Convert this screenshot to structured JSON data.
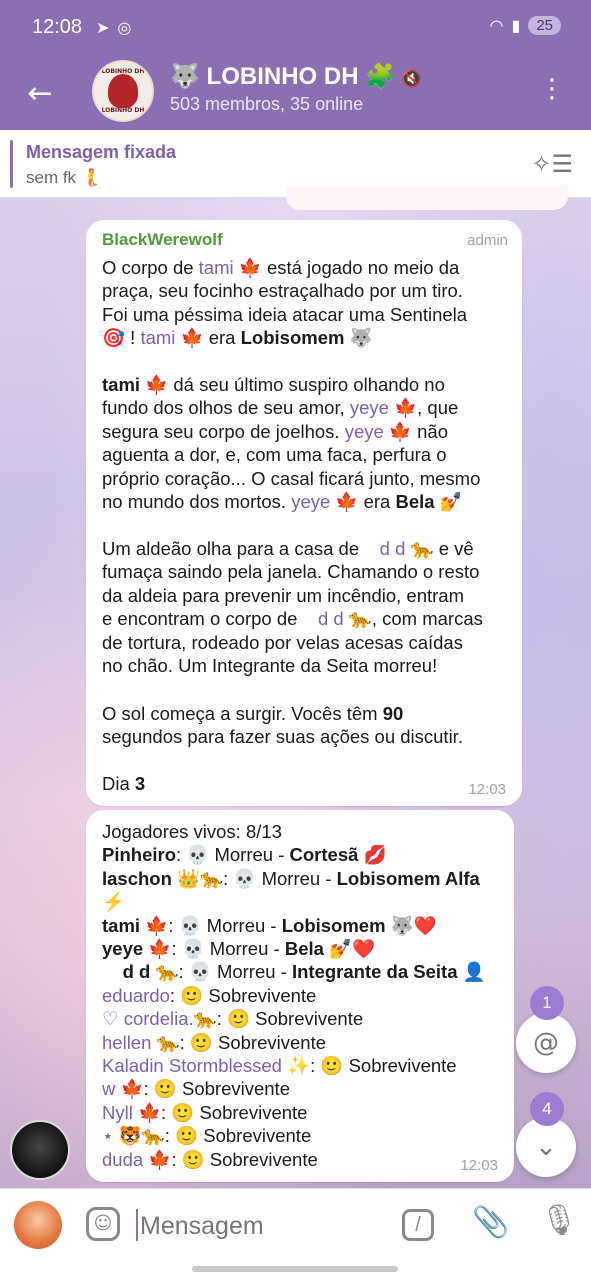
{
  "status_bar": {
    "time": "12:08",
    "icons": [
      "telegram-icon",
      "whatsapp-icon"
    ],
    "battery": "25"
  },
  "header": {
    "title": "🐺 LOBINHO DH 🧩",
    "subtitle": "503 membros, 35 online",
    "avatar_text_top": "LOBINHO DH",
    "avatar_text_bottom": "LOBINHO DH"
  },
  "pinned": {
    "title": "Mensagem fixada",
    "text": "sem fk 🧜"
  },
  "message1": {
    "sender": "BlackWerewolf",
    "role": "admin",
    "time": "12:03",
    "day_label": "Dia ",
    "day_value": "3",
    "seconds": "90"
  },
  "message2": {
    "time": "12:03",
    "alive_line": "Jogadores vivos: 8/13"
  },
  "badges": {
    "mentions": "1",
    "unread": "4"
  },
  "input": {
    "placeholder": "Mensagem",
    "command_label": "/"
  },
  "colors": {
    "header": "#8a6fb3",
    "username": "#7d5fb0",
    "sender": "#4f9a3a"
  }
}
